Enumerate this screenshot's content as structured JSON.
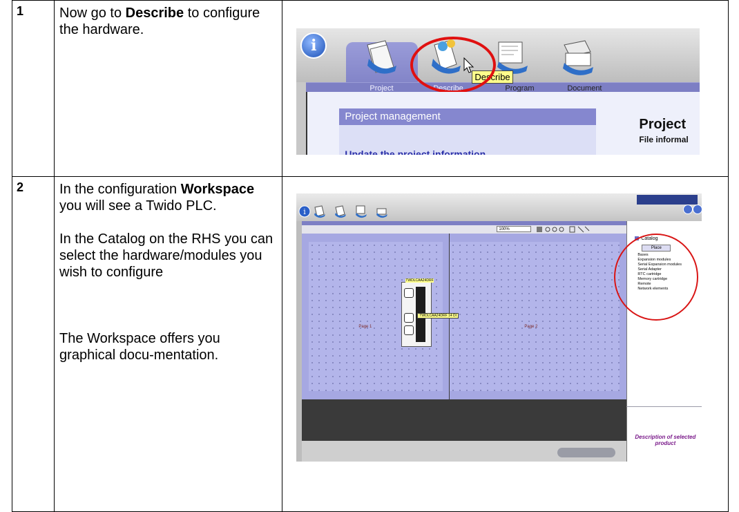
{
  "rows": [
    {
      "number": "1",
      "text_parts": [
        "Now go to ",
        "Describe",
        " to configure the hardware."
      ],
      "screenshot": {
        "tabs": [
          "Project",
          "Describe",
          "Program",
          "Document"
        ],
        "tooltip": "Describe",
        "panel_heading": "Project management",
        "panel_subheading": "Update the project information",
        "right_title": "Project",
        "right_subtitle": "File informal",
        "highlight_color": "#e01010",
        "accent_color": "#7d7fc4"
      }
    },
    {
      "number": "2",
      "para1_parts": [
        "In the configuration ",
        "Workspace",
        " you will see a Twido PLC."
      ],
      "para2": "In the Catalog on the RHS you can select the hardware/modules you wish to configure",
      "para3": "The Workspace offers you graphical docu-mentation.",
      "screenshot": {
        "tabs": [
          "Project",
          "Describe",
          "Program",
          "Document"
        ],
        "zoom_value": "100%",
        "rack_labels": [
          "Page 1",
          "Page 2"
        ],
        "plc_name": "TWDLCAA24DRF",
        "plc_tooltip": "TWDLCAA24DRF 14 DI",
        "catalog_title": "Catalog",
        "catalog_button": "Place",
        "catalog_items": [
          "Bases",
          "Expansion modules",
          "Serial Expansion modules",
          "Serial Adapter",
          "RTC cartridge",
          "Memory cartridge",
          "Remote",
          "Network elements"
        ],
        "description_text": "Description of selected product",
        "highlight_color": "#d91515",
        "accent_color": "#a6a8e2"
      }
    }
  ]
}
